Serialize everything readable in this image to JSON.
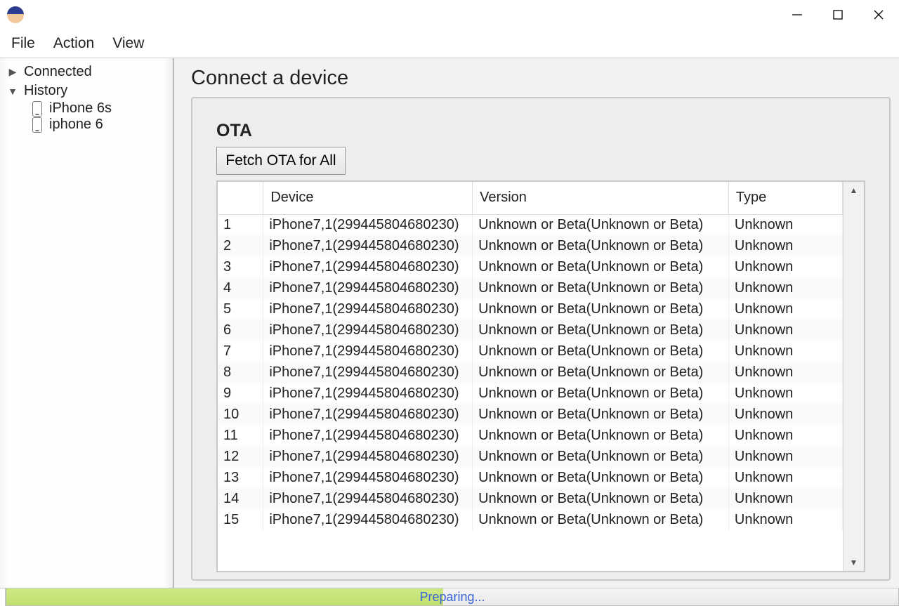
{
  "window": {
    "controls": {
      "minimize": "—",
      "maximize": "□",
      "close": "✕"
    }
  },
  "menu": {
    "file": "File",
    "action": "Action",
    "view": "View"
  },
  "sidebar": {
    "connected": {
      "label": "Connected",
      "expanded": false
    },
    "history": {
      "label": "History",
      "expanded": true,
      "items": [
        {
          "label": "iPhone 6s"
        },
        {
          "label": "iphone 6"
        }
      ]
    }
  },
  "main": {
    "title": "Connect a device",
    "section_label": "OTA",
    "fetch_button": "Fetch OTA for All",
    "columns": {
      "index": "",
      "device": "Device",
      "version": "Version",
      "type": "Type"
    },
    "rows": [
      {
        "n": "1",
        "device": "iPhone7,1(299445804680230)",
        "version": "Unknown or Beta(Unknown or Beta)",
        "type": "Unknown"
      },
      {
        "n": "2",
        "device": "iPhone7,1(299445804680230)",
        "version": "Unknown or Beta(Unknown or Beta)",
        "type": "Unknown"
      },
      {
        "n": "3",
        "device": "iPhone7,1(299445804680230)",
        "version": "Unknown or Beta(Unknown or Beta)",
        "type": "Unknown"
      },
      {
        "n": "4",
        "device": "iPhone7,1(299445804680230)",
        "version": "Unknown or Beta(Unknown or Beta)",
        "type": "Unknown"
      },
      {
        "n": "5",
        "device": "iPhone7,1(299445804680230)",
        "version": "Unknown or Beta(Unknown or Beta)",
        "type": "Unknown"
      },
      {
        "n": "6",
        "device": "iPhone7,1(299445804680230)",
        "version": "Unknown or Beta(Unknown or Beta)",
        "type": "Unknown"
      },
      {
        "n": "7",
        "device": "iPhone7,1(299445804680230)",
        "version": "Unknown or Beta(Unknown or Beta)",
        "type": "Unknown"
      },
      {
        "n": "8",
        "device": "iPhone7,1(299445804680230)",
        "version": "Unknown or Beta(Unknown or Beta)",
        "type": "Unknown"
      },
      {
        "n": "9",
        "device": "iPhone7,1(299445804680230)",
        "version": "Unknown or Beta(Unknown or Beta)",
        "type": "Unknown"
      },
      {
        "n": "10",
        "device": "iPhone7,1(299445804680230)",
        "version": "Unknown or Beta(Unknown or Beta)",
        "type": "Unknown"
      },
      {
        "n": "11",
        "device": "iPhone7,1(299445804680230)",
        "version": "Unknown or Beta(Unknown or Beta)",
        "type": "Unknown"
      },
      {
        "n": "12",
        "device": "iPhone7,1(299445804680230)",
        "version": "Unknown or Beta(Unknown or Beta)",
        "type": "Unknown"
      },
      {
        "n": "13",
        "device": "iPhone7,1(299445804680230)",
        "version": "Unknown or Beta(Unknown or Beta)",
        "type": "Unknown"
      },
      {
        "n": "14",
        "device": "iPhone7,1(299445804680230)",
        "version": "Unknown or Beta(Unknown or Beta)",
        "type": "Unknown"
      },
      {
        "n": "15",
        "device": "iPhone7,1(299445804680230)",
        "version": "Unknown or Beta(Unknown or Beta)",
        "type": "Unknown"
      }
    ]
  },
  "status": {
    "text": "Preparing..."
  }
}
